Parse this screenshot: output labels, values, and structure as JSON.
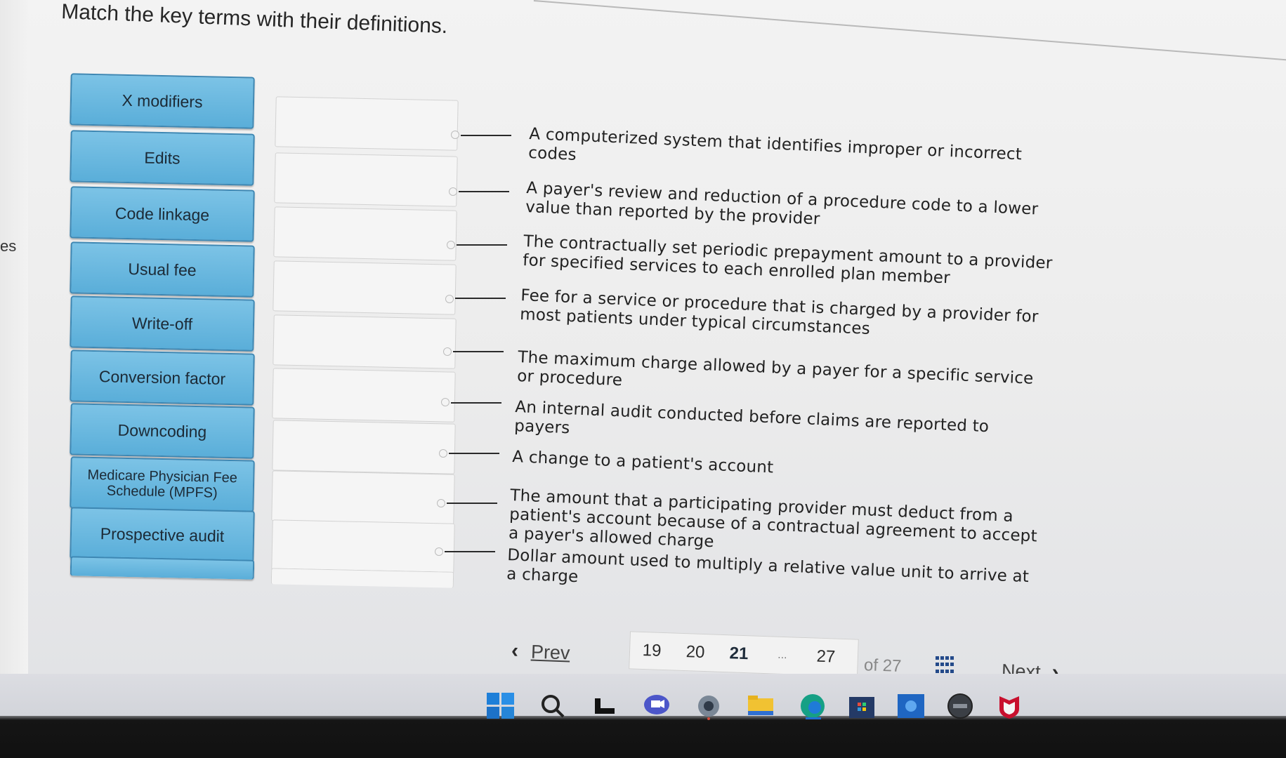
{
  "page": {
    "title": "Match the key terms with their definitions.",
    "left_edge_text": "es"
  },
  "terms": [
    {
      "label": "X modifiers"
    },
    {
      "label": "Edits"
    },
    {
      "label": "Code linkage"
    },
    {
      "label": "Usual fee"
    },
    {
      "label": "Write-off"
    },
    {
      "label": "Conversion factor"
    },
    {
      "label": "Downcoding"
    },
    {
      "label": "Medicare Physician Fee Schedule (MPFS)"
    },
    {
      "label": "Prospective audit"
    },
    {
      "label": ""
    }
  ],
  "definitions": [
    {
      "text": "A computerized system that identifies improper or incorrect codes"
    },
    {
      "text": "A payer's review and reduction of a procedure code to a lower value than reported by the provider"
    },
    {
      "text": "The contractually set periodic prepayment amount to a provider for specified services to each enrolled plan member"
    },
    {
      "text": "Fee for a service or procedure that is charged by a provider for most patients under typical circumstances"
    },
    {
      "text": "The maximum charge allowed by a payer for a specific service or procedure"
    },
    {
      "text": "An internal audit conducted before claims are reported to payers"
    },
    {
      "text": "A change to a patient's account"
    },
    {
      "text": "The amount that a participating provider must deduct from a patient's account because of a contractual agreement to accept a payer's allowed charge"
    },
    {
      "text": "Dollar amount used to multiply a relative value unit to arrive at a charge"
    }
  ],
  "pagination": {
    "prev_label": "Prev",
    "next_label": "Next",
    "pages": [
      "19",
      "20",
      "21",
      "...",
      "27"
    ],
    "current_page": "21",
    "of_label": "of 27"
  },
  "colors": {
    "term_fill": "#6bb8e0",
    "term_border": "#3d87b3",
    "page_bg": "#f0f0f0",
    "link_blue": "#244a8a"
  },
  "taskbar": {
    "icons": [
      "windows-start-icon",
      "search-icon",
      "task-view-icon",
      "chat-icon",
      "settings-icon",
      "file-explorer-icon",
      "edge-browser-icon",
      "microsoft-store-icon",
      "mail-icon",
      "dell-icon",
      "mcafee-icon"
    ]
  }
}
